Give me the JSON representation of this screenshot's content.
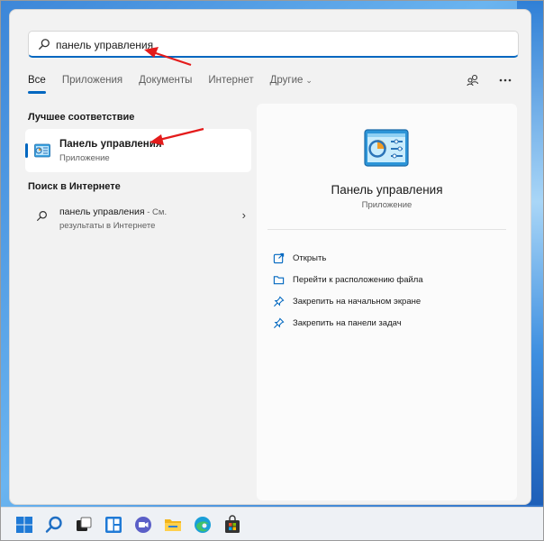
{
  "search": {
    "value": "панель управления"
  },
  "tabs": [
    {
      "label": "Все"
    },
    {
      "label": "Приложения"
    },
    {
      "label": "Документы"
    },
    {
      "label": "Интернет"
    },
    {
      "label": "Другие"
    }
  ],
  "sections": {
    "best_match_title": "Лучшее соответствие",
    "web_title": "Поиск в Интернете"
  },
  "best_match": {
    "name": "Панель управления",
    "type": "Приложение"
  },
  "web_result": {
    "query": "панель управления",
    "suffix": " - См.",
    "line2": "результаты в Интернете"
  },
  "preview": {
    "name": "Панель управления",
    "type": "Приложение",
    "actions": [
      {
        "label": "Открыть",
        "icon": "open-icon"
      },
      {
        "label": "Перейти к расположению файла",
        "icon": "folder-icon"
      },
      {
        "label": "Закрепить на начальном экране",
        "icon": "pin-icon"
      },
      {
        "label": "Закрепить на панели задач",
        "icon": "pin-icon"
      }
    ]
  },
  "taskbar": {
    "items": [
      "windows-start-icon",
      "search-icon",
      "task-view-icon",
      "widgets-icon",
      "chat-icon",
      "file-explorer-icon",
      "edge-icon",
      "store-icon"
    ]
  },
  "colors": {
    "accent": "#0067c0",
    "annotation_arrow": "#e41b1b"
  }
}
